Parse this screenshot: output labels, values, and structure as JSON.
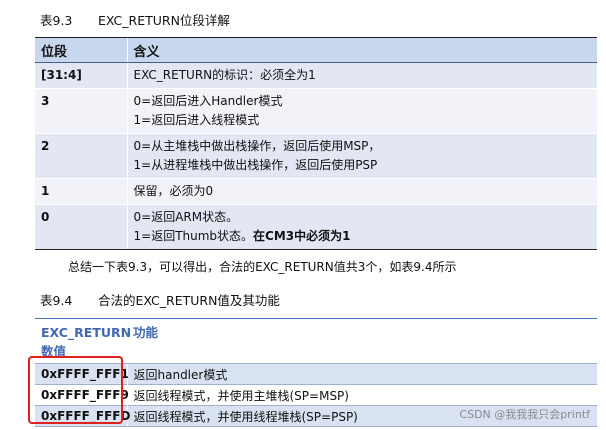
{
  "table1": {
    "caption_num": "表9.3",
    "caption_title": "EXC_RETURN位段详解",
    "headers": [
      "位段",
      "含义"
    ],
    "rows": [
      {
        "bits": "[31:4]",
        "lines": [
          "EXC_RETURN的标识：必须全为1"
        ]
      },
      {
        "bits": "3",
        "lines": [
          "0=返回后进入Handler模式",
          "1=返回后进入线程模式"
        ]
      },
      {
        "bits": "2",
        "lines": [
          "0=从主堆栈中做出栈操作，返回后使用MSP，",
          "1=从进程堆栈中做出栈操作，返回后使用PSP"
        ]
      },
      {
        "bits": "1",
        "lines": [
          "保留，必须为0"
        ]
      },
      {
        "bits": "0",
        "lines": [
          "0=返回ARM状态。",
          "1=返回Thumb状态。"
        ],
        "bold_tail": "在CM3中必须为1"
      }
    ]
  },
  "summary": "总结一下表9.3，可以得出，合法的EXC_RETURN值共3个，如表9.4所示",
  "table2": {
    "caption_num": "表9.4",
    "caption_title": "合法的EXC_RETURN值及其功能",
    "headers": [
      "EXC_RETURN\n数值",
      "功能"
    ],
    "rows": [
      {
        "value": "0xFFFF_FFF1",
        "func": "返回handler模式"
      },
      {
        "value": "0xFFFF_FFF9",
        "func": "返回线程模式，并使用主堆栈(SP=MSP)"
      },
      {
        "value": "0xFFFF_FFFD",
        "func": "返回线程模式，并使用线程堆栈(SP=PSP)"
      }
    ]
  },
  "watermark": "CSDN @我我我只会printf",
  "colors": {
    "header_bg": "#c9d7ee",
    "row_odd": "#e2e7f3",
    "row_even": "#f1f3f9",
    "accent_blue": "#4169b2",
    "highlight_red": "#e0201a"
  }
}
